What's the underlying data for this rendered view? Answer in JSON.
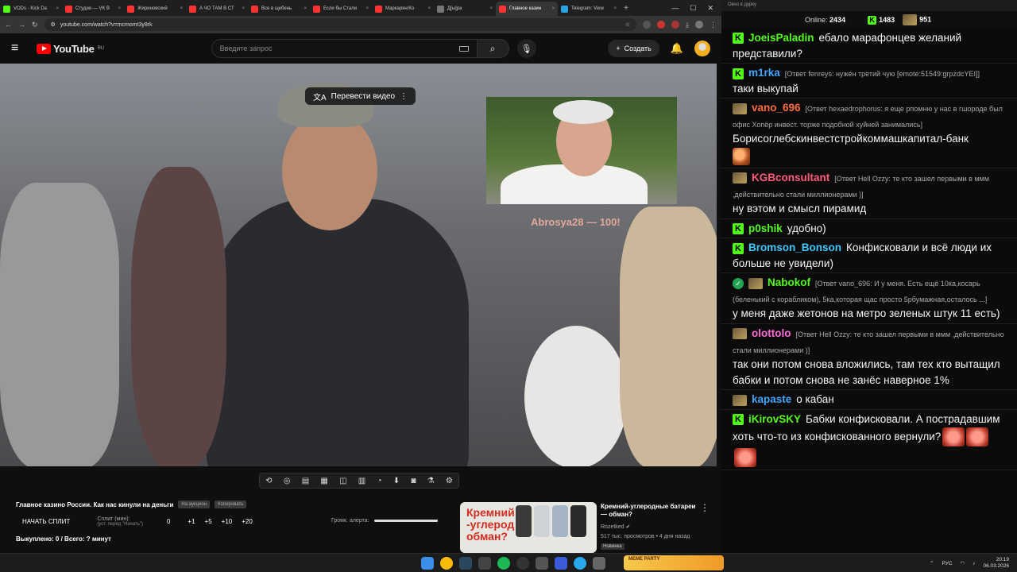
{
  "browser": {
    "tabs": [
      {
        "label": "VODs - Kick Da",
        "color": "#53fc18"
      },
      {
        "label": "Студия — VK В",
        "color": "#ff3333"
      },
      {
        "label": "Жириновский",
        "color": "#ff3333"
      },
      {
        "label": "А ЧО ТАМ В СТ",
        "color": "#ff3333"
      },
      {
        "label": "Все в щебень",
        "color": "#ff3333"
      },
      {
        "label": "Если бы Стали",
        "color": "#ff3333"
      },
      {
        "label": "Маркарян/Ко",
        "color": "#ff3333"
      },
      {
        "label": "Д[ы]ра",
        "color": "#777777"
      },
      {
        "label": "Главное казин",
        "color": "#ff3333",
        "active": true
      },
      {
        "label": "Telegram: View",
        "color": "#2aa3e0"
      }
    ],
    "url": "youtube.com/watch?v=mcmomt3y8rk"
  },
  "youtube": {
    "logo_text": "YouTube",
    "logo_region": "RU",
    "search_placeholder": "Введите запрос",
    "create_label": "Создать"
  },
  "video": {
    "translate_label": "Перевести видео",
    "overlay_text": "Abrosya28 — 100!"
  },
  "below": {
    "title": "Главное казино России. Как нас кинули на деньги",
    "chip1": "На аукцион",
    "chip2": "Копировать",
    "split_button": "НАЧАТЬ СПЛИТ",
    "split_label": "Сплит (мин):",
    "split_sub": "(уст. перед \"Начать\")",
    "split_values": [
      "0",
      "+1",
      "+5",
      "+10",
      "+20"
    ],
    "alert_label": "Громк. алерта:",
    "bought_text": "Выкуплено: 0 / Всего: ? минут"
  },
  "recommended": {
    "thumb_line1": "Кремний",
    "thumb_line2": "-углерод",
    "thumb_line3": "обман?",
    "title": "Кремний-углеродные батареи — обман?",
    "channel": "Rozetked",
    "meta": "517 тыс. просмотров • 4 дня назад",
    "badge": "Новинка"
  },
  "chat_panel": {
    "window_title": "Окно в дурку",
    "online_label": "Online:",
    "online_count": "2434",
    "kick_count": "1483",
    "other_count": "951",
    "messages": [
      {
        "user": "JoeisPaladin",
        "color": "#53fc18",
        "badge": "k",
        "reply": "",
        "text": "ебало марафонцев желаний представили?"
      },
      {
        "user": "m1rka",
        "color": "#3ea6ff",
        "badge": "k",
        "reply": "[Ответ fenreys: нужен третий чую [emote:51549:grpzdcYEI]]",
        "text": "таки выкупай"
      },
      {
        "user": "vano_696",
        "color": "#ff6b3d",
        "badge": "ava",
        "reply": "[Ответ hexaedrophorus: я еще рпомню у нас в гшороде был офис Хопёр инвест. торже подобной хуйней занимались]",
        "text": "Борисоглебскинвестстройкоммашкапитал-банк",
        "emote": true
      },
      {
        "user": "KGBconsultant",
        "color": "#ff5c7a",
        "badge": "ava",
        "reply": "[Ответ Hell Ozzy: те кто зашел первыми в ммм ,действительно стали миллионерами )]",
        "text": "ну вэтом и смысл пирамид"
      },
      {
        "user": "p0shik",
        "color": "#53fc18",
        "badge": "k",
        "reply": "",
        "text": "удобно)"
      },
      {
        "user": "Bromson_Bonson",
        "color": "#3ec9ff",
        "badge": "k",
        "reply": "",
        "text": "Конфисковали и всё люди их больше не увидели)"
      },
      {
        "user": "Nabokof",
        "color": "#53fc18",
        "badge": "green",
        "reply": "[Ответ vano_696: И у меня. Есть ещё 10ка,косарь (беленький с корабликом), 5ка,которая щас просто 5рбумажная,осталось ...]",
        "text": "у меня даже жетонов на метро зеленых штук 11 есть)"
      },
      {
        "user": "olottolo",
        "color": "#ff6bd5",
        "badge": "ava",
        "reply": "[Ответ Hell Ozzy: те кто зашел первыми в ммм ,действительно стали миллионерами )]",
        "text": "так они потом снова вложились, там тех кто вытащил бабки и потом снова не занёс наверное 1%"
      },
      {
        "user": "kapaste",
        "color": "#3ea6ff",
        "badge": "ava",
        "reply": "",
        "text": "о кабан"
      },
      {
        "user": "iKirovSKY",
        "color": "#53fc18",
        "badge": "k",
        "reply": "",
        "text": "Бабки конфисковали. А пострадавшим хоть что-то из конфискованного вернули?",
        "emotes3": true
      }
    ]
  },
  "taskbar": {
    "party_label": "MEME PARTY",
    "lang": "РУС",
    "time": "20:19",
    "date": "06.03.2026"
  }
}
